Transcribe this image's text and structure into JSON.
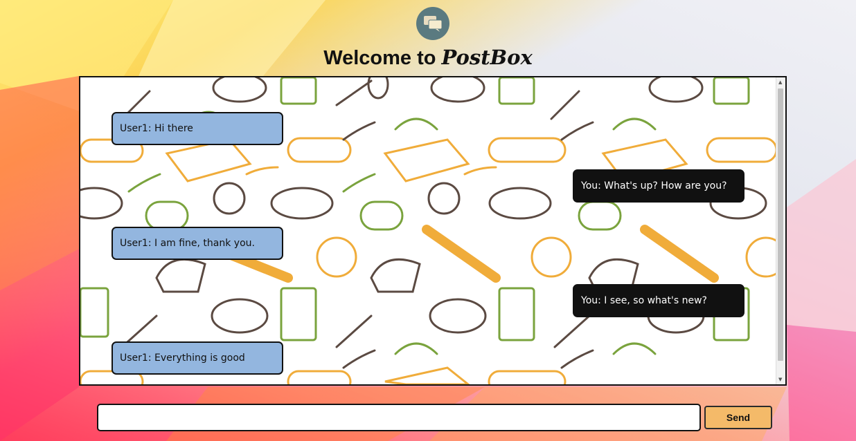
{
  "header": {
    "logo_icon": "chat-bubbles-icon",
    "welcome_text": "Welcome to",
    "brand_name": "PostBox"
  },
  "messages": [
    {
      "direction": "incoming",
      "text": "User1: Hi there"
    },
    {
      "direction": "outgoing",
      "text": "You: What's up? How are you?"
    },
    {
      "direction": "incoming",
      "text": "User1: I am fine, thank you."
    },
    {
      "direction": "outgoing",
      "text": "You: I see, so what's new?"
    },
    {
      "direction": "incoming",
      "text": "User1: Everything is good"
    }
  ],
  "composer": {
    "input_value": "",
    "input_placeholder": "",
    "send_label": "Send"
  },
  "colors": {
    "incoming_bubble": "#93b6df",
    "outgoing_bubble": "#111111",
    "send_button": "#f4ba69"
  }
}
